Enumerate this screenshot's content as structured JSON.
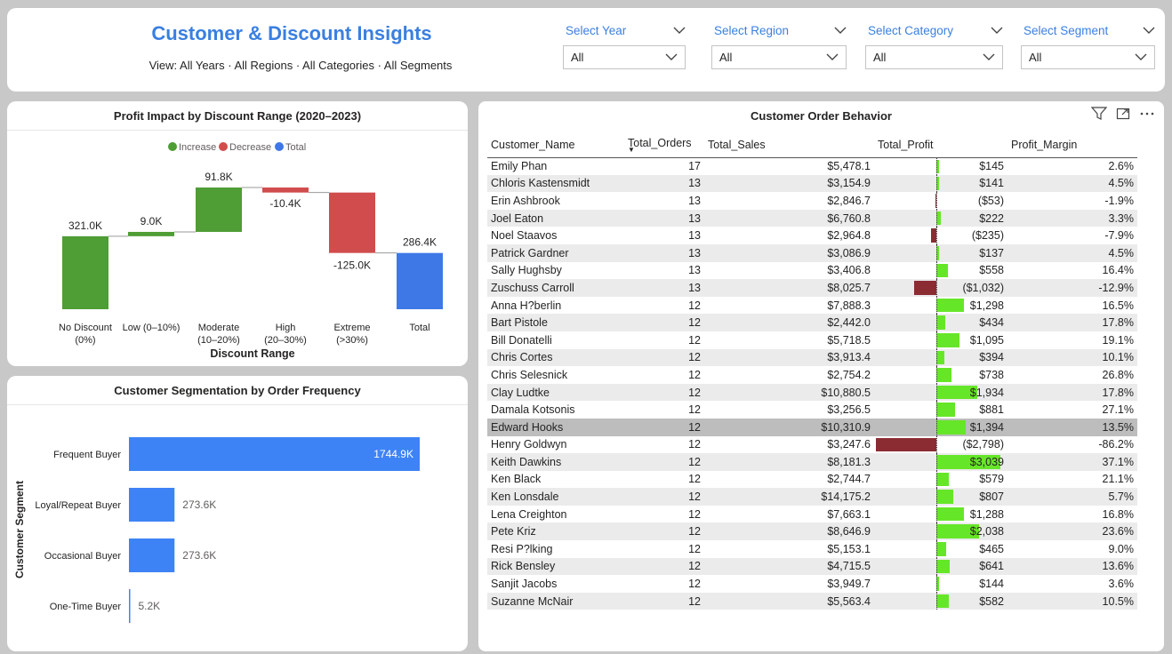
{
  "header": {
    "title": "Customer & Discount Insights",
    "subtitle": "View: All Years · All Regions · All Categories · All Segments"
  },
  "slicers": [
    {
      "label": "Select Year",
      "value": "All"
    },
    {
      "label": "Select Region",
      "value": "All"
    },
    {
      "label": "Select Category",
      "value": "All"
    },
    {
      "label": "Select Segment",
      "value": "All"
    }
  ],
  "waterfall": {
    "title": "Profit Impact by Discount Range (2020–2023)",
    "legend": [
      {
        "label": "Increase",
        "color": "#4e9d35"
      },
      {
        "label": "Decrease",
        "color": "#d14c4c"
      },
      {
        "label": "Total",
        "color": "#3e78e6"
      }
    ],
    "xlabel": "Discount Range"
  },
  "segmentation": {
    "title": "Customer Segmentation by Order Frequency",
    "ylabel": "Customer Segment"
  },
  "table": {
    "title": "Customer Order Behavior",
    "columns": [
      "Customer_Name",
      "Total_Orders",
      "Total_Sales",
      "Total_Profit",
      "Profit_Margin"
    ],
    "selected_row": 15,
    "rows": [
      [
        "Emily Phan",
        "17",
        "$5,478.1",
        "$145",
        "2.6%",
        145
      ],
      [
        "Chloris Kastensmidt",
        "13",
        "$3,154.9",
        "$141",
        "4.5%",
        141
      ],
      [
        "Erin Ashbrook",
        "13",
        "$2,846.7",
        "($53)",
        "-1.9%",
        -53
      ],
      [
        "Joel Eaton",
        "13",
        "$6,760.8",
        "$222",
        "3.3%",
        222
      ],
      [
        "Noel Staavos",
        "13",
        "$2,964.8",
        "($235)",
        "-7.9%",
        -235
      ],
      [
        "Patrick Gardner",
        "13",
        "$3,086.9",
        "$137",
        "4.5%",
        137
      ],
      [
        "Sally Hughsby",
        "13",
        "$3,406.8",
        "$558",
        "16.4%",
        558
      ],
      [
        "Zuschuss Carroll",
        "13",
        "$8,025.7",
        "($1,032)",
        "-12.9%",
        -1032
      ],
      [
        "Anna H?berlin",
        "12",
        "$7,888.3",
        "$1,298",
        "16.5%",
        1298
      ],
      [
        "Bart Pistole",
        "12",
        "$2,442.0",
        "$434",
        "17.8%",
        434
      ],
      [
        "Bill Donatelli",
        "12",
        "$5,718.5",
        "$1,095",
        "19.1%",
        1095
      ],
      [
        "Chris Cortes",
        "12",
        "$3,913.4",
        "$394",
        "10.1%",
        394
      ],
      [
        "Chris Selesnick",
        "12",
        "$2,754.2",
        "$738",
        "26.8%",
        738
      ],
      [
        "Clay Ludtke",
        "12",
        "$10,880.5",
        "$1,934",
        "17.8%",
        1934
      ],
      [
        "Damala Kotsonis",
        "12",
        "$3,256.5",
        "$881",
        "27.1%",
        881
      ],
      [
        "Edward Hooks",
        "12",
        "$10,310.9",
        "$1,394",
        "13.5%",
        1394
      ],
      [
        "Henry Goldwyn",
        "12",
        "$3,247.6",
        "($2,798)",
        "-86.2%",
        -2798
      ],
      [
        "Keith Dawkins",
        "12",
        "$8,181.3",
        "$3,039",
        "37.1%",
        3039
      ],
      [
        "Ken Black",
        "12",
        "$2,744.7",
        "$579",
        "21.1%",
        579
      ],
      [
        "Ken Lonsdale",
        "12",
        "$14,175.2",
        "$807",
        "5.7%",
        807
      ],
      [
        "Lena Creighton",
        "12",
        "$7,663.1",
        "$1,288",
        "16.8%",
        1288
      ],
      [
        "Pete Kriz",
        "12",
        "$8,646.9",
        "$2,038",
        "23.6%",
        2038
      ],
      [
        "Resi P?lking",
        "12",
        "$5,153.1",
        "$465",
        "9.0%",
        465
      ],
      [
        "Rick Bensley",
        "12",
        "$4,715.5",
        "$641",
        "13.6%",
        641
      ],
      [
        "Sanjit Jacobs",
        "12",
        "$3,949.7",
        "$144",
        "3.6%",
        144
      ],
      [
        "Suzanne McNair",
        "12",
        "$5,563.4",
        "$582",
        "10.5%",
        582
      ]
    ]
  },
  "chart_data": [
    {
      "type": "bar",
      "subtype": "waterfall",
      "title": "Profit Impact by Discount Range (2020–2023)",
      "xlabel": "Discount Range",
      "categories": [
        "No Discount\n(0%)",
        "Low (0–10%)",
        "Moderate\n(10–20%)",
        "High\n(20–30%)",
        "Extreme\n(>30%)",
        "Total"
      ],
      "values": [
        321.0,
        9.0,
        91.8,
        -10.4,
        -125.0,
        286.4
      ],
      "value_labels": [
        "321.0K",
        "9.0K",
        "91.8K",
        "-10.4K",
        "-125.0K",
        "286.4K"
      ],
      "kinds": [
        "increase",
        "increase",
        "increase",
        "decrease",
        "decrease",
        "total"
      ],
      "legend": [
        "Increase",
        "Decrease",
        "Total"
      ],
      "legend_position": "top-center",
      "colors": {
        "increase": "#4e9d35",
        "decrease": "#d14c4c",
        "total": "#3e78e6"
      },
      "grid": false
    },
    {
      "type": "bar",
      "orientation": "horizontal",
      "title": "Customer Segmentation by Order Frequency",
      "ylabel": "Customer Segment",
      "categories": [
        "Frequent Buyer",
        "Loyal/Repeat Buyer",
        "Occasional Buyer",
        "One-Time Buyer"
      ],
      "values": [
        1744.9,
        273.6,
        273.6,
        5.2
      ],
      "value_labels": [
        "1744.9K",
        "273.6K",
        "273.6K",
        "5.2K"
      ],
      "color": "#3e83f5",
      "grid": false
    }
  ]
}
